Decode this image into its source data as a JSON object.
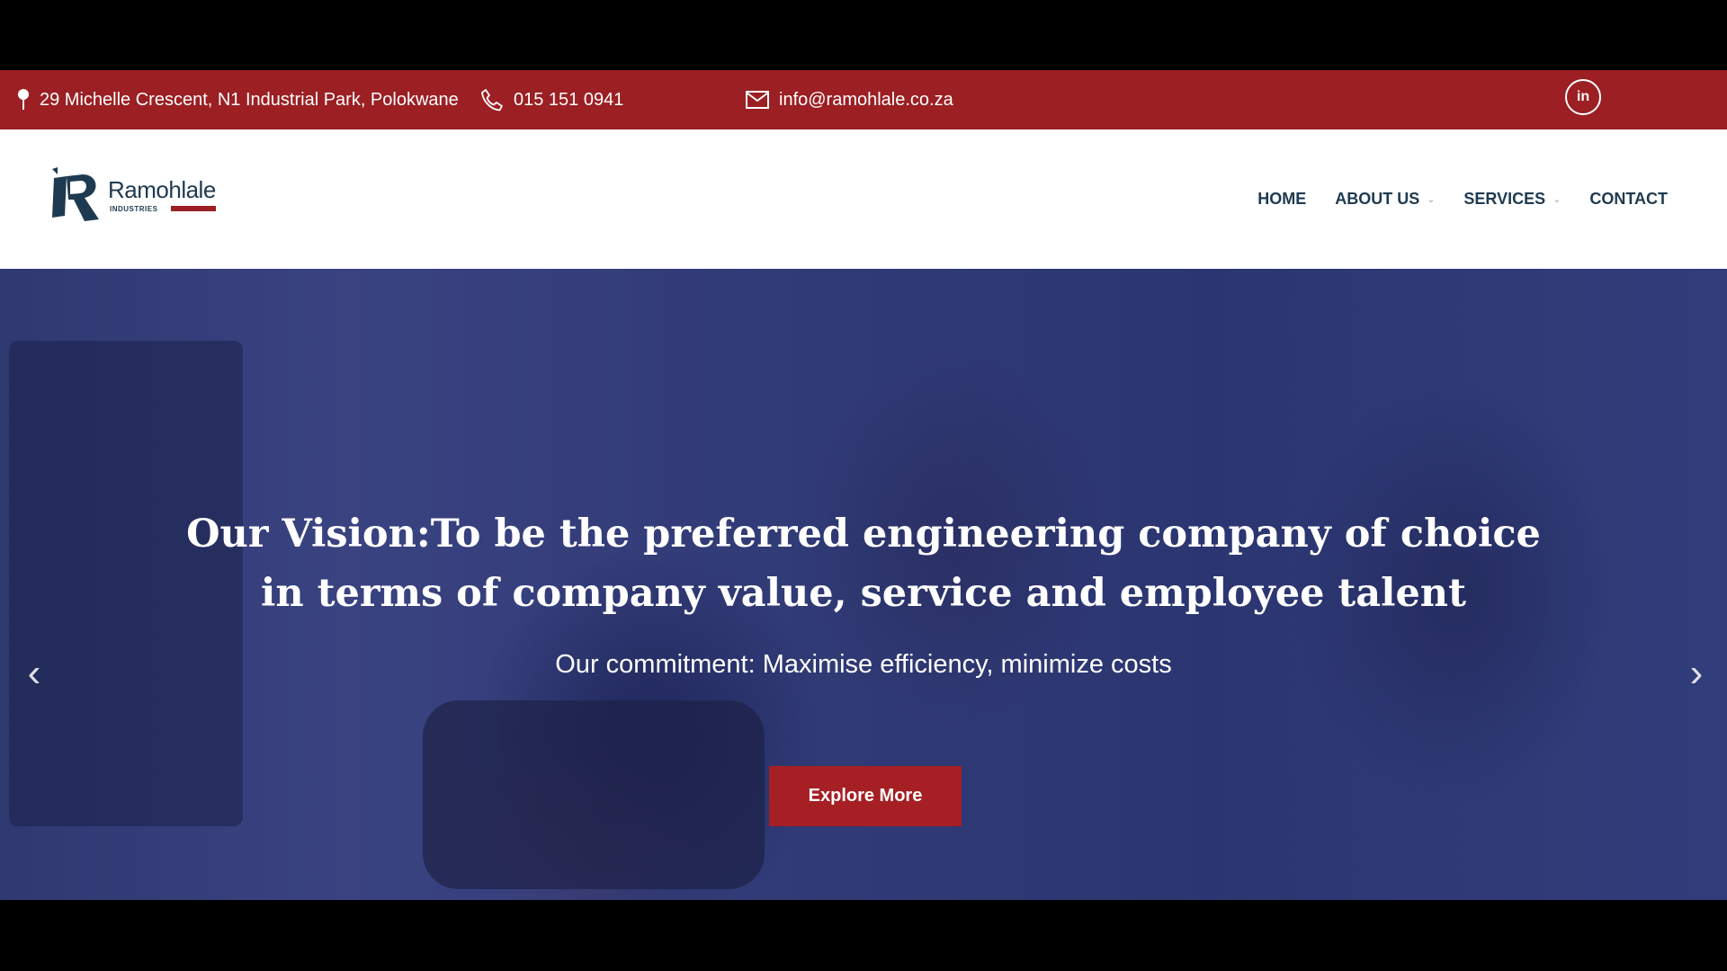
{
  "topbar": {
    "address": "29 Michelle Crescent, N1 Industrial Park, Polokwane",
    "phone": "015 151 0941",
    "email": "info@ramohlale.co.za",
    "linkedin_label": "in"
  },
  "logo": {
    "name": "Ramohlale",
    "sub": "INDUSTRIES"
  },
  "nav": {
    "items": [
      {
        "label": "HOME",
        "has_dropdown": false
      },
      {
        "label": "ABOUT US",
        "has_dropdown": true
      },
      {
        "label": "SERVICES",
        "has_dropdown": true
      },
      {
        "label": "CONTACT",
        "has_dropdown": false
      }
    ]
  },
  "hero": {
    "title": "Our Vision:To be the preferred engineering company of choice in terms of company value, service and employee talent",
    "subtitle": "Our commitment: Maximise efficiency, minimize costs",
    "button": "Explore More"
  },
  "colors": {
    "brand_red": "#9b1f23",
    "navy": "#1e3a50"
  }
}
